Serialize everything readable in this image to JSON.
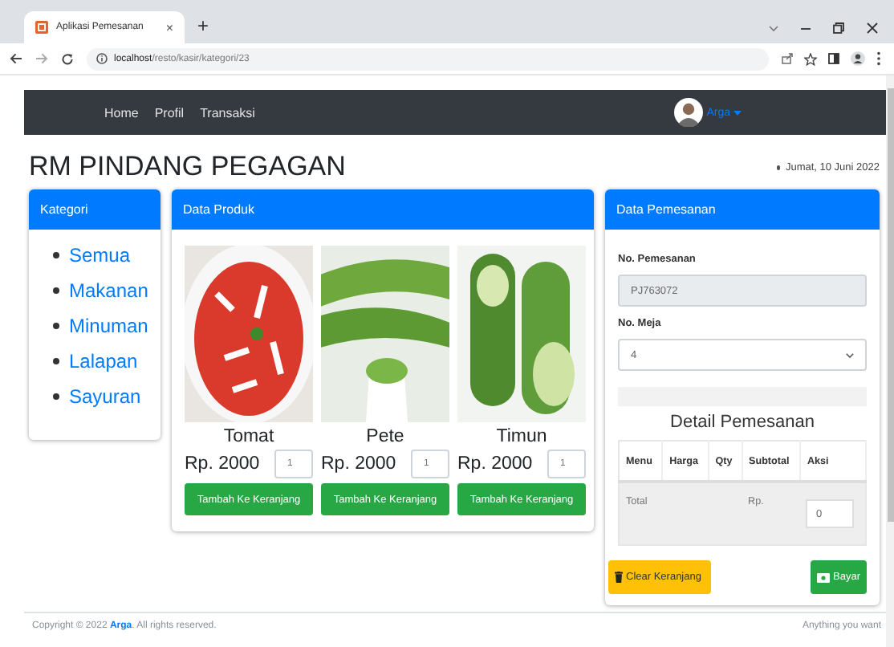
{
  "browser": {
    "tab_title": "Aplikasi Pemesanan",
    "tab_close": "×",
    "new_tab": "+",
    "url_host": "localhost",
    "url_path": "/resto/kasir/kategori/23"
  },
  "navbar": {
    "links": [
      {
        "label": "Home"
      },
      {
        "label": "Profil"
      },
      {
        "label": "Transaksi"
      }
    ],
    "user": "Arga"
  },
  "title": "RM PINDANG PEGAGAN",
  "date": "Jumat, 10 Juni 2022",
  "kategori": {
    "header": "Kategori",
    "items": [
      "Semua",
      "Makanan",
      "Minuman",
      "Lalapan",
      "Sayuran"
    ]
  },
  "produk": {
    "header": "Data Produk",
    "items": [
      {
        "name": "Tomat",
        "price": "Rp. 2000",
        "qty": "1",
        "button": "Tambah Ke Keranjang",
        "kind": "tomato"
      },
      {
        "name": "Pete",
        "price": "Rp. 2000",
        "qty": "1",
        "button": "Tambah Ke Keranjang",
        "kind": "beans"
      },
      {
        "name": "Timun",
        "price": "Rp. 2000",
        "qty": "1",
        "button": "Tambah Ke Keranjang",
        "kind": "cucumber"
      }
    ]
  },
  "pemesanan": {
    "header": "Data Pemesanan",
    "order_label": "No. Pemesanan",
    "order_value": "PJ763072",
    "table_label": "No. Meja",
    "table_value": "4",
    "detail_title": "Detail Pemesanan",
    "columns": [
      "Menu",
      "Harga",
      "Qty",
      "Subtotal",
      "Aksi"
    ],
    "total_label": "Total",
    "total_currency": "Rp.",
    "total_value": "0",
    "clear_button": "Clear Keranjang",
    "pay_button": "Bayar"
  },
  "footer": {
    "copyright": "Copyright © 2022",
    "author": "Arga",
    "rights": ". All rights reserved.",
    "right_text": "Anything you want"
  }
}
